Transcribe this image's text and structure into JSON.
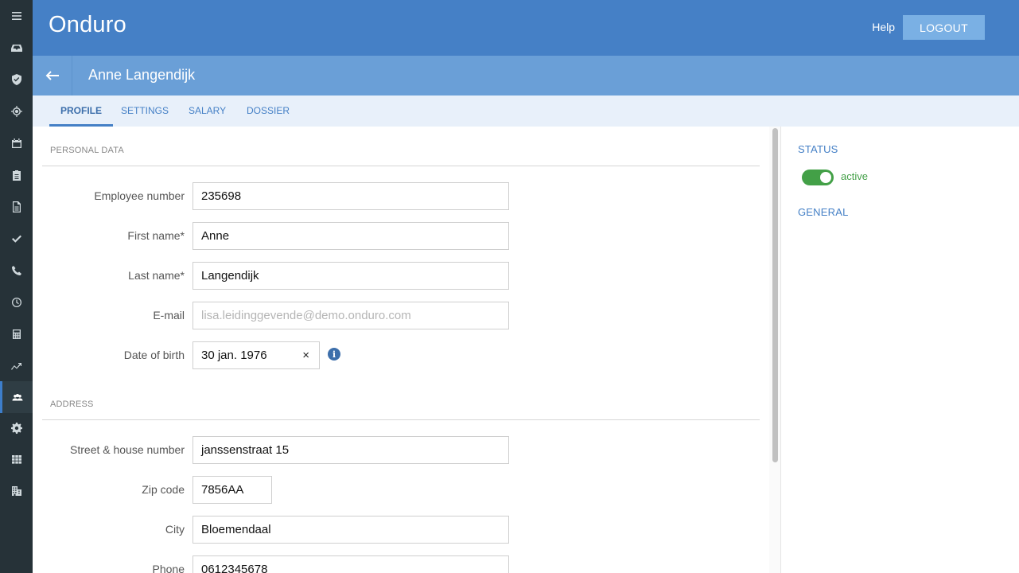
{
  "app": {
    "title": "Onduro"
  },
  "header": {
    "help_label": "Help",
    "logout_label": "LOGOUT"
  },
  "subheader": {
    "name": "Anne Langendijk"
  },
  "tabs": [
    {
      "label": "PROFILE",
      "active": true
    },
    {
      "label": "SETTINGS",
      "active": false
    },
    {
      "label": "SALARY",
      "active": false
    },
    {
      "label": "DOSSIER",
      "active": false
    }
  ],
  "sidebar": {
    "items": [
      {
        "icon": "menu-icon"
      },
      {
        "icon": "inbox-icon"
      },
      {
        "icon": "badge-check-icon"
      },
      {
        "icon": "target-icon"
      },
      {
        "icon": "calendar-icon"
      },
      {
        "icon": "clipboard-icon"
      },
      {
        "icon": "document-icon"
      },
      {
        "icon": "checkmark-icon"
      },
      {
        "icon": "phone-icon"
      },
      {
        "icon": "clock-icon"
      },
      {
        "icon": "calculator-icon"
      },
      {
        "icon": "trend-icon"
      },
      {
        "icon": "people-icon",
        "active": true
      },
      {
        "icon": "gear-icon"
      },
      {
        "icon": "grid-icon"
      },
      {
        "icon": "building-icon"
      }
    ]
  },
  "personal_data": {
    "section_title": "PERSONAL DATA",
    "employee_number": {
      "label": "Employee number",
      "value": "235698"
    },
    "first_name": {
      "label": "First name*",
      "value": "Anne"
    },
    "last_name": {
      "label": "Last name*",
      "value": "Langendijk"
    },
    "email": {
      "label": "E-mail",
      "placeholder": "lisa.leidinggevende@demo.onduro.com"
    },
    "date_of_birth": {
      "label": "Date of birth",
      "value": "30 jan. 1976",
      "clear": "×",
      "info": "i"
    }
  },
  "address": {
    "section_title": "ADDRESS",
    "street": {
      "label": "Street & house number",
      "value": "janssenstraat 15"
    },
    "zip": {
      "label": "Zip code",
      "value": "7856AA"
    },
    "city": {
      "label": "City",
      "value": "Bloemendaal"
    },
    "phone": {
      "label": "Phone",
      "value": "0612345678"
    }
  },
  "right_panel": {
    "status_heading": "STATUS",
    "status_label": "active",
    "status_on": true,
    "general_heading": "GENERAL"
  },
  "colors": {
    "header": "#4580c6",
    "subheader": "#6a9fd7",
    "tabbar": "#e8f0fa",
    "rail": "#263238",
    "toggle_on": "#43a047"
  }
}
